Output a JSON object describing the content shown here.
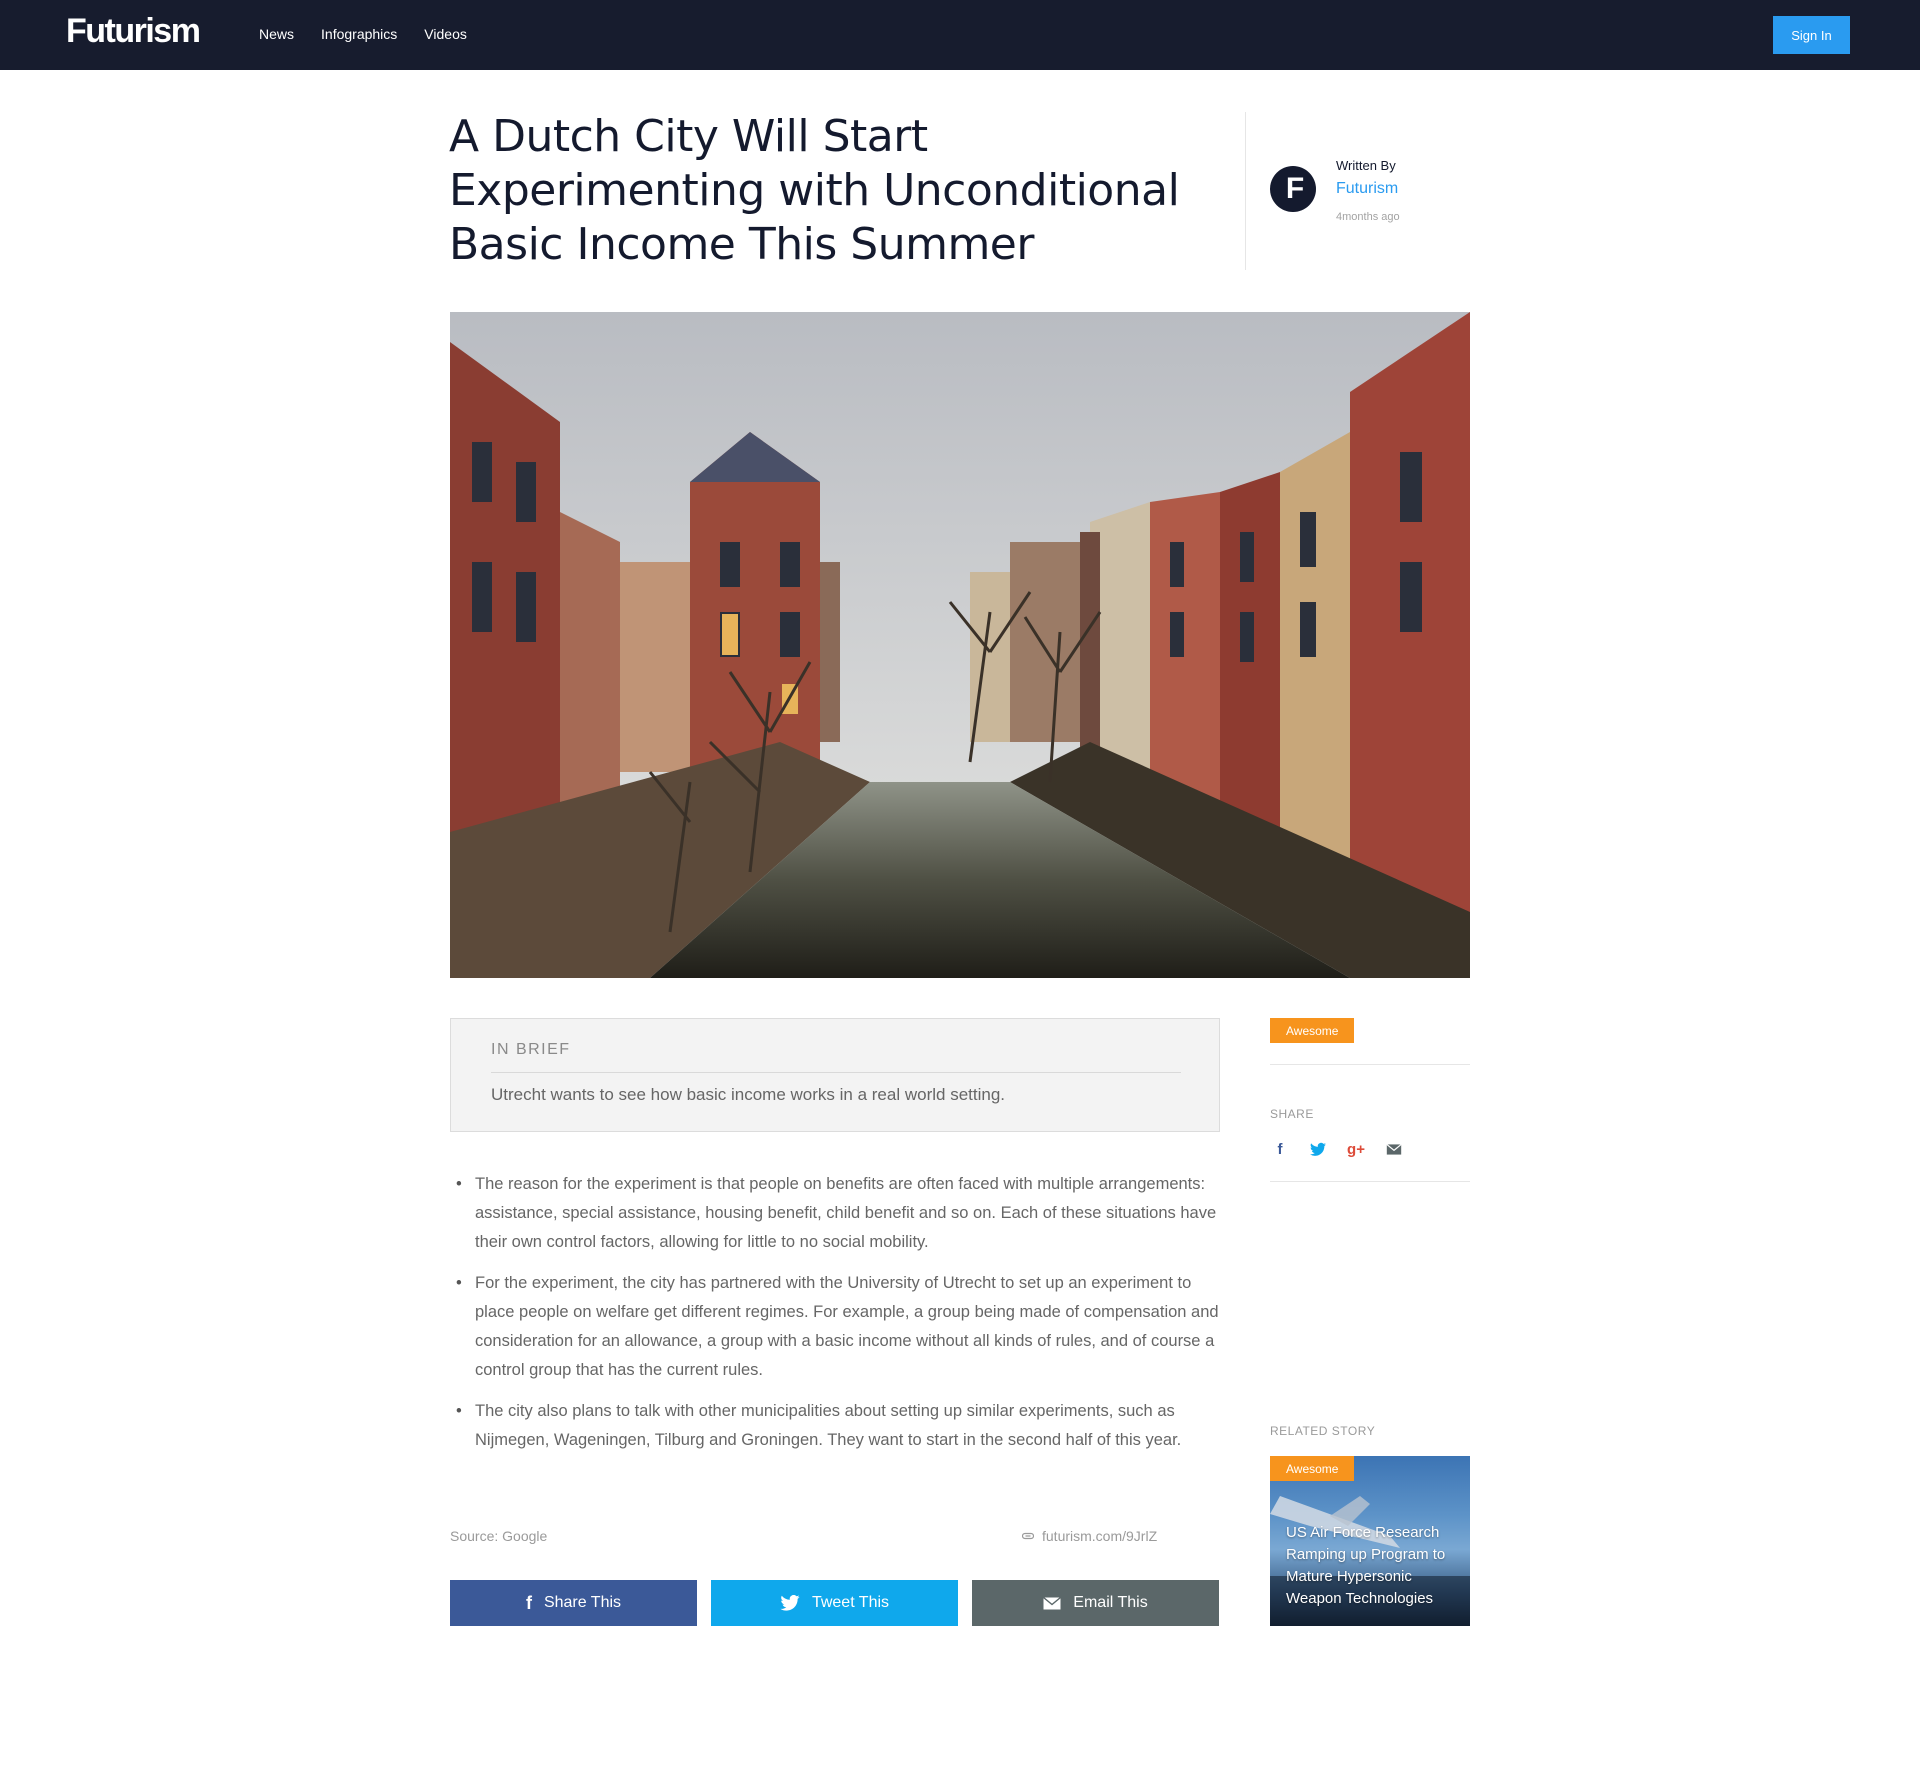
{
  "brand": {
    "logo": "Futurism"
  },
  "nav": {
    "items": [
      "News",
      "Infographics",
      "Videos"
    ],
    "sign_in": "Sign In"
  },
  "article": {
    "title": "A Dutch City Will Start Experimenting with Unconditional Basic Income This Summer",
    "written_by": "Written By",
    "author": "Futurism",
    "avatar_letter": "F",
    "published": "4months ago",
    "in_brief": {
      "heading": "IN BRIEF",
      "text": "Utrecht wants to see how basic income works in a real world setting."
    },
    "bullets": [
      "The reason for the experiment is that people on benefits are often faced with multiple arrangements: assistance, special assistance, housing benefit, child benefit and so on. Each of these situations have their own control factors, allowing for little to no social mobility.",
      "For the experiment, the city has partnered with the University of Utrecht to set up an experiment to place people on welfare get different regimes. For example, a group being made of compensation and consideration for an allowance, a group with a basic income without all kinds of rules, and of course a control group that has the current rules.",
      "The city also plans to talk with other municipalities about setting up similar experiments, such as Nijmegen, Wageningen, Tilburg and Groningen. They want to start in the second half of this year."
    ],
    "source": "Source: Google",
    "short_link": "futurism.com/9JrlZ"
  },
  "share_buttons": {
    "facebook": "Share This",
    "twitter": "Tweet This",
    "email": "Email This"
  },
  "sidebar": {
    "tag": "Awesome",
    "share_label": "SHARE",
    "share_icons": {
      "facebook": "f",
      "google_plus": "g+"
    },
    "related_label": "RELATED STORY",
    "related": {
      "tag": "Awesome",
      "title": "US Air Force Research Ramping up Program to Mature Hypersonic Weapon Technologies"
    }
  },
  "colors": {
    "nav_bg": "#171c2e",
    "accent_blue": "#2a9bf0",
    "tag_orange": "#f7941d",
    "facebook": "#3b5998",
    "twitter": "#0fa8ec",
    "email": "#5b6769"
  },
  "icons": [
    "facebook-icon",
    "twitter-icon",
    "google-plus-icon",
    "mail-icon",
    "link-icon"
  ]
}
